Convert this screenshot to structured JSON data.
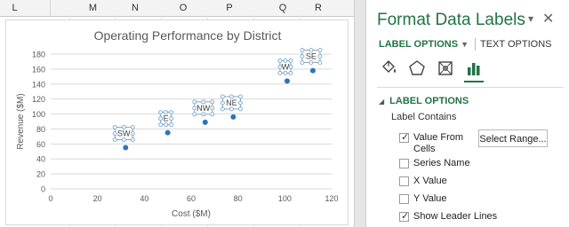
{
  "spreadsheet": {
    "columns": [
      "L",
      "M",
      "N",
      "O",
      "P",
      "Q",
      "R"
    ]
  },
  "chart_data": {
    "type": "scatter",
    "title": "Operating Performance by District",
    "xlabel": "Cost ($M)",
    "ylabel": "Revenue ($M)",
    "xlim": [
      0,
      120
    ],
    "ylim": [
      0,
      180
    ],
    "xticks": [
      0,
      20,
      40,
      60,
      80,
      100,
      120
    ],
    "yticks": [
      0,
      20,
      40,
      60,
      80,
      100,
      120,
      140,
      160,
      180
    ],
    "grid": true,
    "marker_color": "#2e75b6",
    "points": [
      {
        "x": 32,
        "y": 55,
        "label": "SW"
      },
      {
        "x": 50,
        "y": 75,
        "label": "E"
      },
      {
        "x": 66,
        "y": 89,
        "label": "NW"
      },
      {
        "x": 78,
        "y": 96,
        "label": "NE"
      },
      {
        "x": 101,
        "y": 144,
        "label": "W"
      },
      {
        "x": 112,
        "y": 158,
        "label": "SE"
      }
    ]
  },
  "panel": {
    "title": "Format Data Labels",
    "tabs": {
      "label_options": "LABEL OPTIONS",
      "text_options": "TEXT OPTIONS"
    },
    "icons": [
      "fill-bucket-icon",
      "pentagon-icon",
      "size-properties-icon",
      "bar-chart-icon"
    ],
    "section_title": "LABEL OPTIONS",
    "label_contains": "Label Contains",
    "value_from_cells_line1": "Value From",
    "value_from_cells_line2": "Cells",
    "value_from_cells_checked": true,
    "select_range": "Select Range...",
    "options": [
      {
        "label": "Series Name",
        "checked": false
      },
      {
        "label": "X Value",
        "checked": false
      },
      {
        "label": "Y Value",
        "checked": false
      },
      {
        "label": "Show Leader Lines",
        "checked": true
      }
    ],
    "accent_color": "#217346"
  }
}
